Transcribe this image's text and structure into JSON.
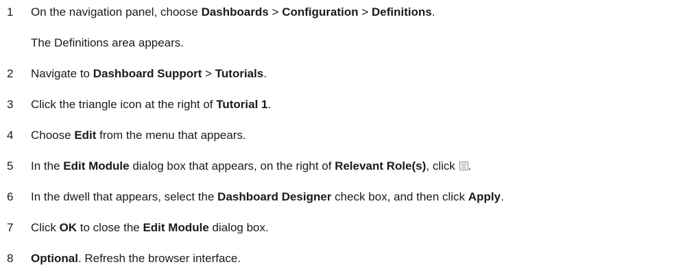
{
  "steps": [
    {
      "number": "1",
      "parts": [
        {
          "t": "On the navigation panel, choose "
        },
        {
          "t": "Dashboards",
          "b": true
        },
        {
          "t": " > "
        },
        {
          "t": "Configuration",
          "b": true
        },
        {
          "t": " > "
        },
        {
          "t": "Definitions",
          "b": true
        },
        {
          "t": "."
        }
      ],
      "note": "The Definitions area appears."
    },
    {
      "number": "2",
      "parts": [
        {
          "t": "Navigate to "
        },
        {
          "t": "Dashboard Support",
          "b": true
        },
        {
          "t": " > "
        },
        {
          "t": "Tutorials",
          "b": true
        },
        {
          "t": "."
        }
      ]
    },
    {
      "number": "3",
      "parts": [
        {
          "t": "Click the triangle icon at the right of "
        },
        {
          "t": "Tutorial 1",
          "b": true
        },
        {
          "t": "."
        }
      ]
    },
    {
      "number": "4",
      "parts": [
        {
          "t": "Choose "
        },
        {
          "t": "Edit",
          "b": true
        },
        {
          "t": " from the menu that appears."
        }
      ]
    },
    {
      "number": "5",
      "parts": [
        {
          "t": "In the "
        },
        {
          "t": "Edit Module",
          "b": true
        },
        {
          "t": " dialog box that appears, on the right of "
        },
        {
          "t": "Relevant Role(s)",
          "b": true
        },
        {
          "t": ", click "
        },
        {
          "icon": "list-icon"
        },
        {
          "t": "."
        }
      ]
    },
    {
      "number": "6",
      "parts": [
        {
          "t": "In the dwell that appears, select the "
        },
        {
          "t": "Dashboard Designer",
          "b": true
        },
        {
          "t": " check box, and then click "
        },
        {
          "t": "Apply",
          "b": true
        },
        {
          "t": "."
        }
      ]
    },
    {
      "number": "7",
      "parts": [
        {
          "t": "Click "
        },
        {
          "t": "OK",
          "b": true
        },
        {
          "t": " to close the "
        },
        {
          "t": "Edit Module",
          "b": true
        },
        {
          "t": " dialog box."
        }
      ]
    },
    {
      "number": "8",
      "parts": [
        {
          "t": "Optional",
          "b": true
        },
        {
          "t": ". Refresh the browser interface."
        }
      ]
    }
  ]
}
